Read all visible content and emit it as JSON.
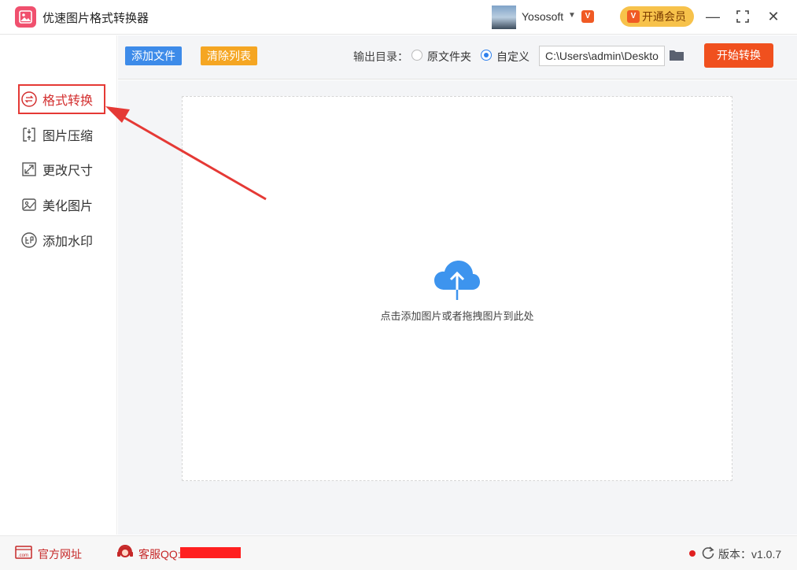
{
  "app": {
    "title": "优速图片格式转换器"
  },
  "user": {
    "name": "Yososoft"
  },
  "vip": {
    "badge": "V",
    "button_label": "开通会员"
  },
  "window_controls": {
    "minimize": "—",
    "maximize": "⛶",
    "close": "✕"
  },
  "sidebar": {
    "items": [
      {
        "label": "格式转换",
        "icon": "format-convert-icon",
        "active": true
      },
      {
        "label": "图片压缩",
        "icon": "compress-icon",
        "active": false
      },
      {
        "label": "更改尺寸",
        "icon": "resize-icon",
        "active": false
      },
      {
        "label": "美化图片",
        "icon": "beautify-icon",
        "active": false
      },
      {
        "label": "添加水印",
        "icon": "watermark-icon",
        "active": false
      }
    ]
  },
  "toolbar": {
    "add_files": "添加文件",
    "clear_list": "清除列表",
    "output_label": "输出目录：",
    "option_source": "原文件夹",
    "option_custom": "自定义",
    "selected_option": "自定义",
    "output_path": "C:\\Users\\admin\\Desktop",
    "start": "开始转换"
  },
  "dropzone": {
    "hint": "点击添加图片或者拖拽图片到此处"
  },
  "footer": {
    "website": "官方网址",
    "support_qq": "客服QQ:",
    "version": "版本：v1.0.7"
  },
  "colors": {
    "primary_blue": "#3d8be9",
    "clear_orange": "#f5a623",
    "start_red": "#f0501e",
    "highlight_red": "#e53935",
    "vip_gold": "#f7c24b"
  }
}
